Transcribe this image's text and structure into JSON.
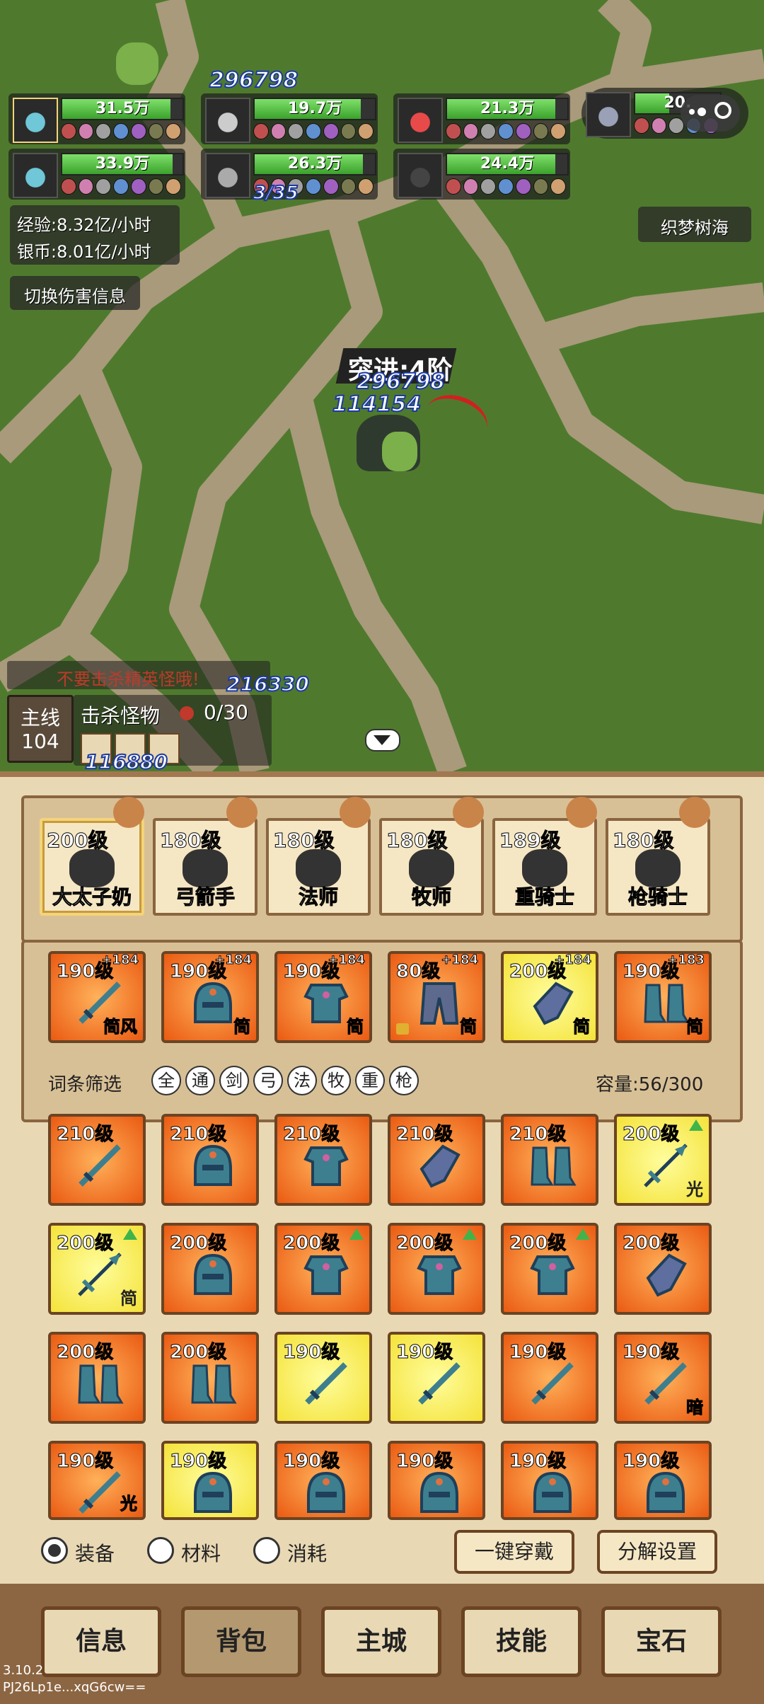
{
  "heroes_row1": [
    {
      "hp": "31.5万",
      "hp_frac": 0.9,
      "color": "#6fc7d8"
    },
    {
      "hp": "19.7万",
      "hp_frac": 0.88,
      "color": "#cccccc"
    },
    {
      "hp": "21.3万",
      "hp_frac": 0.9,
      "color": "#e84a4a"
    },
    {
      "hp": "20.",
      "hp_frac": 0.4,
      "color": "#9aa0b5"
    }
  ],
  "heroes_row2": [
    {
      "hp": "33.9万",
      "hp_frac": 0.92,
      "color": "#6fc7d8"
    },
    {
      "hp": "26.3万",
      "hp_frac": 0.9,
      "color": "#aaaaaa"
    },
    {
      "hp": "24.4万",
      "hp_frac": 0.9,
      "color": "#444444"
    }
  ],
  "damage_numbers": {
    "top": "296798",
    "mid1": "296798",
    "mid2": "114154",
    "lower": "216330",
    "lower2": "3/35",
    "bottom": "116880"
  },
  "stats": {
    "exp": "经验:8.32亿/小时",
    "silver": "银币:8.01亿/小时"
  },
  "map_name": "织梦树海",
  "toggle_damage_label": "切换伤害信息",
  "breakthrough": "突进:4阶",
  "warning": "不要击杀精英怪哦!",
  "quest": {
    "main_label": "主线",
    "main_num": "104",
    "title": "击杀怪物",
    "progress": "0/30"
  },
  "characters": [
    {
      "level": "200级",
      "name": "大太子奶",
      "selected": true
    },
    {
      "level": "180级",
      "name": "弓箭手",
      "selected": false
    },
    {
      "level": "180级",
      "name": "法师",
      "selected": false
    },
    {
      "level": "180级",
      "name": "牧师",
      "selected": false
    },
    {
      "level": "189级",
      "name": "重骑士",
      "selected": false
    },
    {
      "level": "180级",
      "name": "枪骑士",
      "selected": false
    }
  ],
  "equipped": [
    {
      "level": "190级",
      "plus": "+184",
      "tag": "简风",
      "type": "sword",
      "color": "orange"
    },
    {
      "level": "190级",
      "plus": "+184",
      "tag": "简",
      "type": "helm",
      "color": "orange"
    },
    {
      "level": "190级",
      "plus": "+184",
      "tag": "简",
      "type": "armor",
      "color": "orange"
    },
    {
      "level": "80级",
      "plus": "+184",
      "tag": "简",
      "type": "pants",
      "color": "orange"
    },
    {
      "level": "200级",
      "plus": "+184",
      "tag": "简",
      "type": "glove",
      "color": "yellow"
    },
    {
      "level": "190级",
      "plus": "+183",
      "tag": "简",
      "type": "boots",
      "color": "orange"
    }
  ],
  "filter": {
    "label": "词条筛选",
    "chips": [
      "全",
      "通",
      "剑",
      "弓",
      "法",
      "牧",
      "重",
      "枪"
    ],
    "capacity": "容量:56/300"
  },
  "inventory": [
    {
      "level": "210级",
      "type": "sword",
      "color": "orange",
      "tag": "",
      "up": false
    },
    {
      "level": "210级",
      "type": "helm",
      "color": "orange",
      "tag": "",
      "up": false
    },
    {
      "level": "210级",
      "type": "armor",
      "color": "orange",
      "tag": "",
      "up": false
    },
    {
      "level": "210级",
      "type": "glove",
      "color": "orange",
      "tag": "",
      "up": false
    },
    {
      "level": "210级",
      "type": "boots",
      "color": "orange",
      "tag": "",
      "up": false
    },
    {
      "level": "200级",
      "type": "spear",
      "color": "yellow",
      "tag": "光",
      "up": true
    },
    {
      "level": "200级",
      "type": "spear",
      "color": "yellow",
      "tag": "简",
      "up": true
    },
    {
      "level": "200级",
      "type": "helm",
      "color": "orange",
      "tag": "",
      "up": false
    },
    {
      "level": "200级",
      "type": "armor",
      "color": "orange",
      "tag": "",
      "up": true
    },
    {
      "level": "200级",
      "type": "armor",
      "color": "orange",
      "tag": "",
      "up": true
    },
    {
      "level": "200级",
      "type": "armor",
      "color": "orange",
      "tag": "",
      "up": true
    },
    {
      "level": "200级",
      "type": "glove",
      "color": "orange",
      "tag": "",
      "up": false
    },
    {
      "level": "200级",
      "type": "boots",
      "color": "orange",
      "tag": "",
      "up": false
    },
    {
      "level": "200级",
      "type": "boots",
      "color": "orange",
      "tag": "",
      "up": false
    },
    {
      "level": "190级",
      "type": "sword",
      "color": "yellow",
      "tag": "",
      "up": false
    },
    {
      "level": "190级",
      "type": "sword",
      "color": "yellow",
      "tag": "",
      "up": false
    },
    {
      "level": "190级",
      "type": "sword",
      "color": "orange",
      "tag": "",
      "up": false
    },
    {
      "level": "190级",
      "type": "sword",
      "color": "orange",
      "tag": "暗",
      "up": false
    },
    {
      "level": "190级",
      "type": "sword",
      "color": "orange",
      "tag": "光",
      "up": false
    },
    {
      "level": "190级",
      "type": "helm",
      "color": "yellow",
      "tag": "",
      "up": false
    },
    {
      "level": "190级",
      "type": "helm",
      "color": "orange",
      "tag": "",
      "up": false
    },
    {
      "level": "190级",
      "type": "helm",
      "color": "orange",
      "tag": "",
      "up": false
    },
    {
      "level": "190级",
      "type": "helm",
      "color": "orange",
      "tag": "",
      "up": false
    },
    {
      "level": "190级",
      "type": "helm",
      "color": "orange",
      "tag": "",
      "up": false
    }
  ],
  "tabs": {
    "equip": "装备",
    "material": "材料",
    "consume": "消耗"
  },
  "actions": {
    "equip_all": "一键穿戴",
    "decompose": "分解设置"
  },
  "nav": [
    "信息",
    "背包",
    "主城",
    "技能",
    "宝石"
  ],
  "version": "3.10.2",
  "device_id": "PJ26Lp1e...xqG6cw=="
}
